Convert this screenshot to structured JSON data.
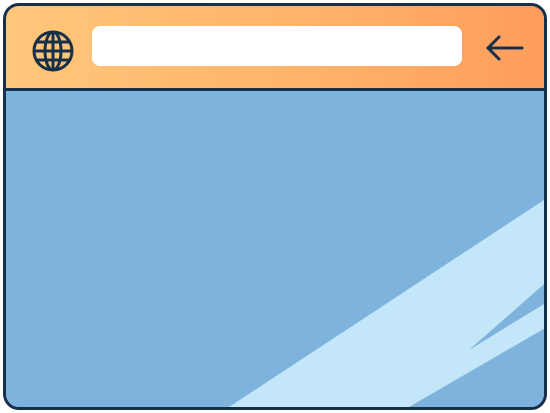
{
  "window": {
    "address_bar": {
      "value": "",
      "placeholder": ""
    },
    "icons": {
      "globe": "globe-icon",
      "back": "arrow-left-icon"
    },
    "colors": {
      "outline": "#17304a",
      "titlebar_start": "#ffc77a",
      "titlebar_end": "#ff9d5c",
      "content": "#7db3dc",
      "glare": "#c3e6f8",
      "address_bar": "#ffffff"
    }
  }
}
